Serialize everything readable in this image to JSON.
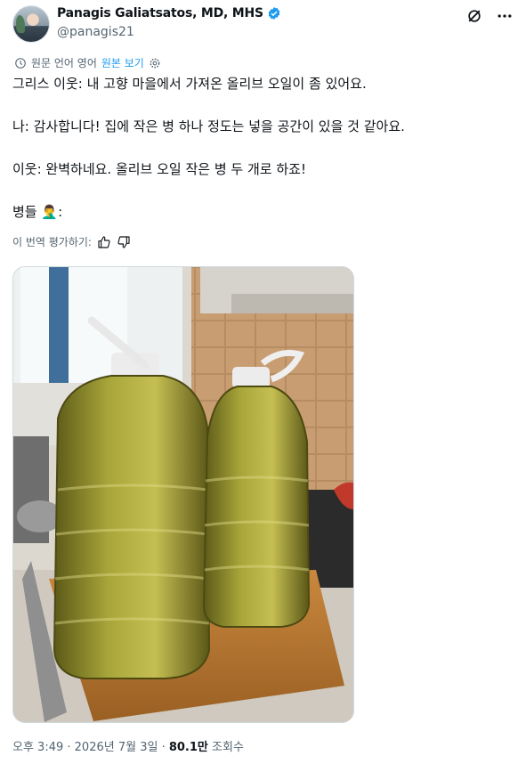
{
  "author": {
    "name": "Panagis Galiatsatos, MD, MHS",
    "handle": "@panagis21",
    "verified": true
  },
  "header_icons": [
    "grok-icon",
    "more-icon"
  ],
  "translation": {
    "label": "원문 언어 영어",
    "link": "원본 보기"
  },
  "tweet": {
    "lines": [
      "그리스 이웃: 내 고향 마을에서 가져온 올리브 오일이 좀 있어요.",
      "나: 감사합니다! 집에 작은 병 하나 정도는 넣을 공간이 있을 것 같아요.",
      "이웃: 완벽하네요. 올리브 오일 작은 병 두 개로 하죠!",
      "병들"
    ],
    "emoji": "🤦‍♂️",
    "colon": ":"
  },
  "rate": {
    "label": "이 번역 평가하기:"
  },
  "meta": {
    "time": "오후 3:49",
    "date": "2026년 7월 3일",
    "views": "80.1만",
    "views_label": "조회수"
  },
  "colors": {
    "accent": "#1d9bf0",
    "text": "#0f1419",
    "muted": "#536471"
  }
}
